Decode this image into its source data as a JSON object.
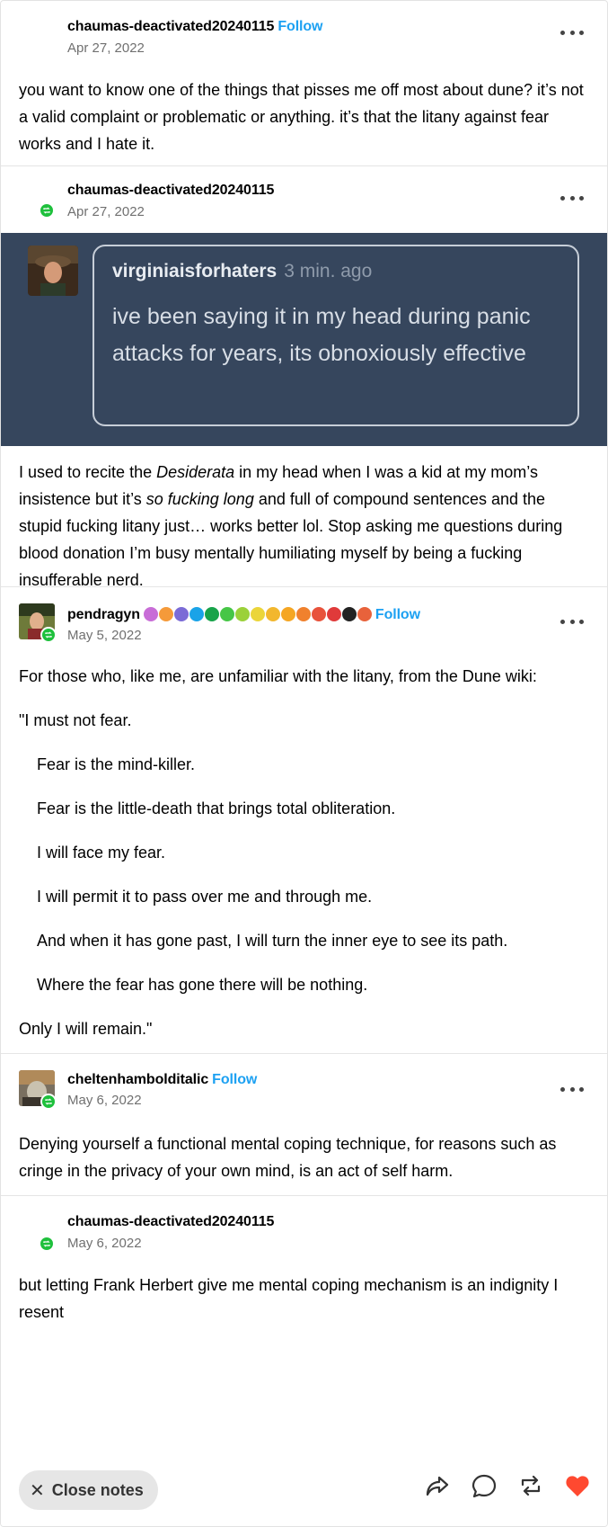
{
  "posts": [
    {
      "username": "chaumas-deactivated20240115",
      "follow": "Follow",
      "date": "Apr 27, 2022",
      "text": "you want to know one of the things that pisses me off most about dune? it’s not a valid complaint or problematic or anything. it’s that the litany against fear works and I hate it."
    },
    {
      "username": "chaumas-deactivated20240115",
      "date": "Apr 27, 2022",
      "ask": {
        "asker": "virginiaisforhaters",
        "time": "3 min. ago",
        "text": "ive been saying it in my head during panic attacks for years, its obnoxiously effective"
      },
      "text_a": "I used to recite the ",
      "text_em1": "Desiderata",
      "text_b": " in my head when I was a kid at my mom’s insistence but it’s ",
      "text_em2": "so fucking long",
      "text_c": " and full of compound sentences and the stupid fucking litany just… works better lol. Stop asking me questions during blood donation I’m busy mentally humiliating myself by being a fucking insufferable nerd."
    },
    {
      "username": "pendragyn",
      "follow": "Follow",
      "date": "May 5, 2022",
      "intro": "For those who, like me, are unfamiliar with the litany, from the Dune wiki:",
      "litany": [
        "\"I must not fear.",
        "Fear is the mind-killer.",
        "Fear is the little-death that brings total obliteration.",
        "I will face my fear.",
        "I will permit it to pass over me and through me.",
        "And when it has gone past, I will turn the inner eye to see its path.",
        "Where the fear has gone there will be nothing.",
        "Only I will remain.\""
      ],
      "badge_colors": [
        "#c86dd7",
        "#f59a3a",
        "#7b6bd6",
        "#1aa3e8",
        "#18a34a",
        "#46c646",
        "#9bd13a",
        "#ebd53a",
        "#f2b72e",
        "#f5a623",
        "#f0812d",
        "#e8523b",
        "#e03a3a",
        "#222222",
        "#e8623b"
      ]
    },
    {
      "username": "cheltenhambolditalic",
      "follow": "Follow",
      "date": "May 6, 2022",
      "text": "Denying yourself a functional mental coping technique, for reasons such as cringe in the privacy of your own mind, is an act of self harm."
    },
    {
      "username": "chaumas-deactivated20240115",
      "date": "May 6, 2022",
      "text": "but letting Frank Herbert give me mental coping mechanism is an indignity I resent"
    }
  ],
  "footer": {
    "close_label": "Close notes",
    "icons": [
      "share-icon",
      "reply-icon",
      "reblog-icon",
      "like-icon"
    ]
  },
  "colors": {
    "follow": "#1da1f2",
    "reblog_badge": "#1ec03c",
    "ask_bg": "#36465d",
    "like": "#ff4930"
  }
}
